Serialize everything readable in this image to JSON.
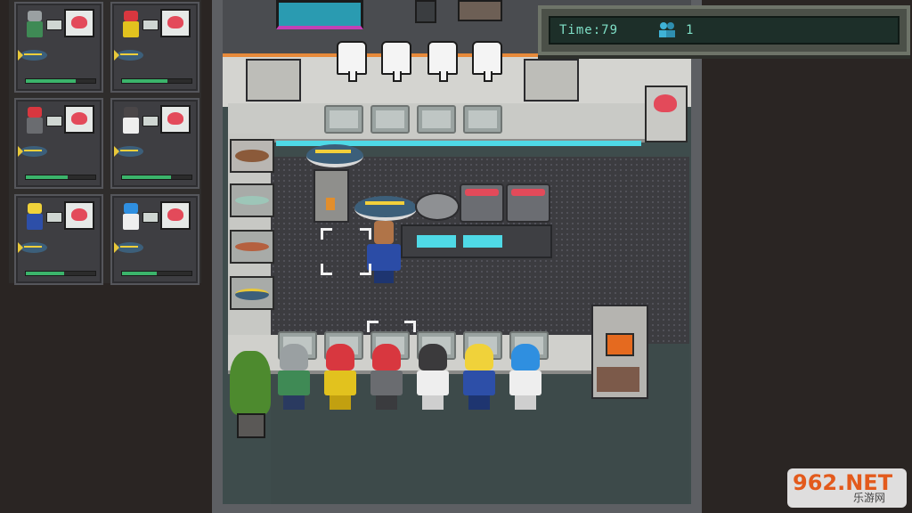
{
  "hud": {
    "time_label": "Time:79",
    "players_icon": "players-icon",
    "players_count": "1"
  },
  "orders": [
    {
      "customer": "gray-hair-green-suit",
      "hair_color": "#9aa0a2",
      "suit_color": "#3f8a55",
      "dish": "fish-fillet",
      "fish": "yellowfin-tuna",
      "patience": 0.72
    },
    {
      "customer": "red-hair-yellow-suit",
      "hair_color": "#d8373f",
      "suit_color": "#e2c21e",
      "dish": "fish-fillet",
      "fish": "yellowfin-tuna",
      "patience": 0.65
    },
    {
      "customer": "red-hair-gray-suit",
      "hair_color": "#d8373f",
      "suit_color": "#6a6c70",
      "dish": "fish-fillet",
      "fish": "yellowfin-tuna",
      "patience": 0.6
    },
    {
      "customer": "dark-hair-white-suit",
      "hair_color": "#4a4648",
      "suit_color": "#eeeeee",
      "dish": "fish-fillet",
      "fish": "yellowfin-tuna",
      "patience": 0.7
    },
    {
      "customer": "blonde-hair-blue-suit",
      "hair_color": "#f0d23a",
      "suit_color": "#2d4fa8",
      "dish": "fish-fillet",
      "fish": "yellowfin-tuna",
      "patience": 0.55
    },
    {
      "customer": "blue-hair-white-suit",
      "hair_color": "#2f8fe0",
      "suit_color": "#eeeeee",
      "dish": "fish-fillet",
      "fish": "yellowfin-tuna",
      "patience": 0.5
    }
  ],
  "queue": [
    {
      "hair": "#9aa0a2",
      "suit": "#3f8a55",
      "legs": "#2a3a60"
    },
    {
      "hair": "#d8373f",
      "suit": "#e2c21e",
      "legs": "#c2a010"
    },
    {
      "hair": "#d8373f",
      "suit": "#6a6c70",
      "legs": "#3a3b3e"
    },
    {
      "hair": "#3b3a3c",
      "suit": "#eeeeee",
      "legs": "#cfcfcf"
    },
    {
      "hair": "#f0d23a",
      "suit": "#2d4fa8",
      "legs": "#1e3570"
    },
    {
      "hair": "#2f8fe0",
      "suit": "#eeeeee",
      "legs": "#cfcfcf"
    }
  ],
  "watermark": {
    "brand": "962.NET",
    "sub": "乐游网"
  },
  "colors": {
    "accent_orange": "#e78a3a",
    "glow_cyan": "#4fd9e6",
    "fillet_red": "#e34a5a",
    "hud_text": "#7fe0c7"
  }
}
